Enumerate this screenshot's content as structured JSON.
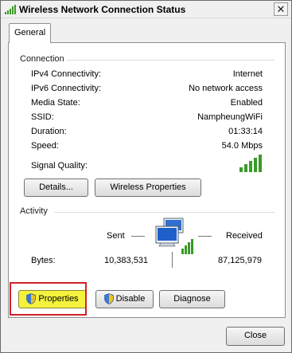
{
  "window": {
    "title": "Wireless Network Connection Status"
  },
  "tabs": [
    {
      "label": "General"
    }
  ],
  "connection": {
    "heading": "Connection",
    "rows": [
      {
        "label": "IPv4 Connectivity:",
        "value": "Internet"
      },
      {
        "label": "IPv6 Connectivity:",
        "value": "No network access"
      },
      {
        "label": "Media State:",
        "value": "Enabled"
      },
      {
        "label": "SSID:",
        "value": "NampheungWiFi"
      },
      {
        "label": "Duration:",
        "value": "01:33:14"
      },
      {
        "label": "Speed:",
        "value": "54.0 Mbps"
      }
    ],
    "signal_label": "Signal Quality:",
    "signal_bars": 5,
    "details_button": "Details...",
    "wireless_properties_button": "Wireless Properties"
  },
  "activity": {
    "heading": "Activity",
    "sent_label": "Sent",
    "received_label": "Received",
    "bytes_label": "Bytes:",
    "bytes_sent": "10,383,531",
    "bytes_received": "87,125,979"
  },
  "actions": {
    "properties_button": "Properties",
    "disable_button": "Disable",
    "diagnose_button": "Diagnose"
  },
  "footer": {
    "close_button": "Close"
  },
  "colors": {
    "highlight": "#d21f2a",
    "properties_fill": "#f4f23d",
    "signal": "#3a9a2a"
  }
}
